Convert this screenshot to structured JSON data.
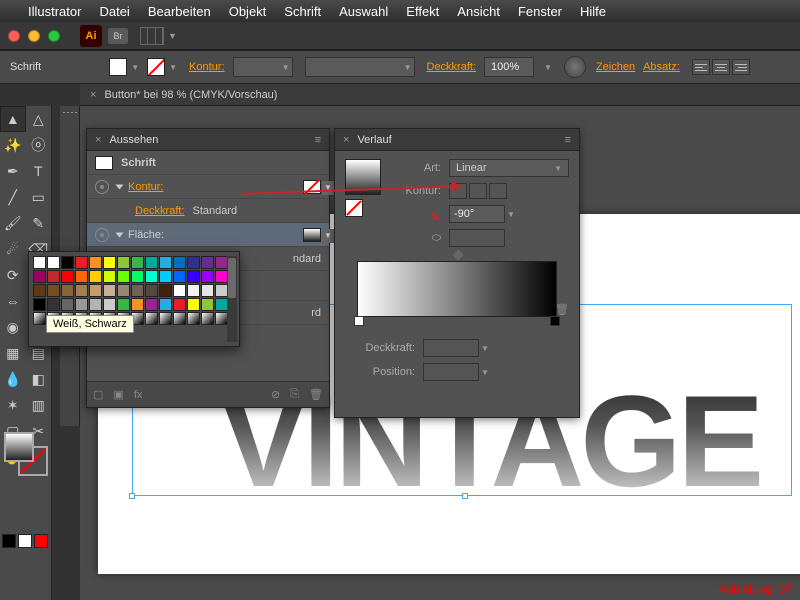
{
  "menubar": [
    "Illustrator",
    "Datei",
    "Bearbeiten",
    "Objekt",
    "Schrift",
    "Auswahl",
    "Effekt",
    "Ansicht",
    "Fenster",
    "Hilfe"
  ],
  "app_logo": "Ai",
  "bridge_badge": "Br",
  "controlbar": {
    "context": "Schrift",
    "kontur_label": "Kontur:",
    "deckkraft_label": "Deckkraft:",
    "deckkraft_value": "100%",
    "zeichen": "Zeichen",
    "absatz": "Absatz:"
  },
  "doctab": {
    "title": "Button* bei 98 % (CMYK/Vorschau)"
  },
  "canvas_text": "VINTAGE",
  "appearance": {
    "title": "Aussehen",
    "object": "Schrift",
    "kontur": "Kontur:",
    "deckkraft": "Deckkraft:",
    "default": "Standard",
    "flaeche": "Fläche:",
    "ndard": "ndard",
    "rd": "rd",
    "foot_label": "fx"
  },
  "gradient": {
    "title": "Verlauf",
    "art_label": "Art:",
    "art_value": "Linear",
    "kontur_label": "Kontur:",
    "angle_value": "-90°",
    "deckkraft_label": "Deckkraft:",
    "position_label": "Position:"
  },
  "swatch_popup": {
    "tooltip": "Weiß, Schwarz",
    "colors_row1": [
      "#ffffff",
      "#ffffff",
      "#000000",
      "#ed1c24",
      "#f7931e",
      "#ffff00",
      "#8cc63f",
      "#39b54a",
      "#00a99d",
      "#29abe2",
      "#0071bc",
      "#2e3192",
      "#662d91",
      "#93278f"
    ],
    "colors_row2": [
      "#9e005d",
      "#c1272d",
      "#ff0000",
      "#ff6600",
      "#ffcc00",
      "#ccff00",
      "#66ff00",
      "#00ff66",
      "#00ffcc",
      "#00ccff",
      "#0066ff",
      "#3300ff",
      "#9900ff",
      "#ff00cc"
    ],
    "colors_row3": [
      "#603813",
      "#754c24",
      "#8c6239",
      "#a67c52",
      "#c69c6d",
      "#c7b299",
      "#998675",
      "#736357",
      "#534741",
      "#42210b",
      "#ffffff",
      "#f2f2f2",
      "#e6e6e6",
      "#cccccc"
    ],
    "colors_row4": [
      "#000000",
      "#333333",
      "#666666",
      "#999999",
      "#b3b3b3",
      "#cccccc",
      "#39b54a",
      "#f7931e",
      "#93278f",
      "#29abe2",
      "#ed1c24",
      "#ffff00",
      "#8cc63f",
      "#00a99d"
    ]
  },
  "caption": "Abbildung: 07"
}
